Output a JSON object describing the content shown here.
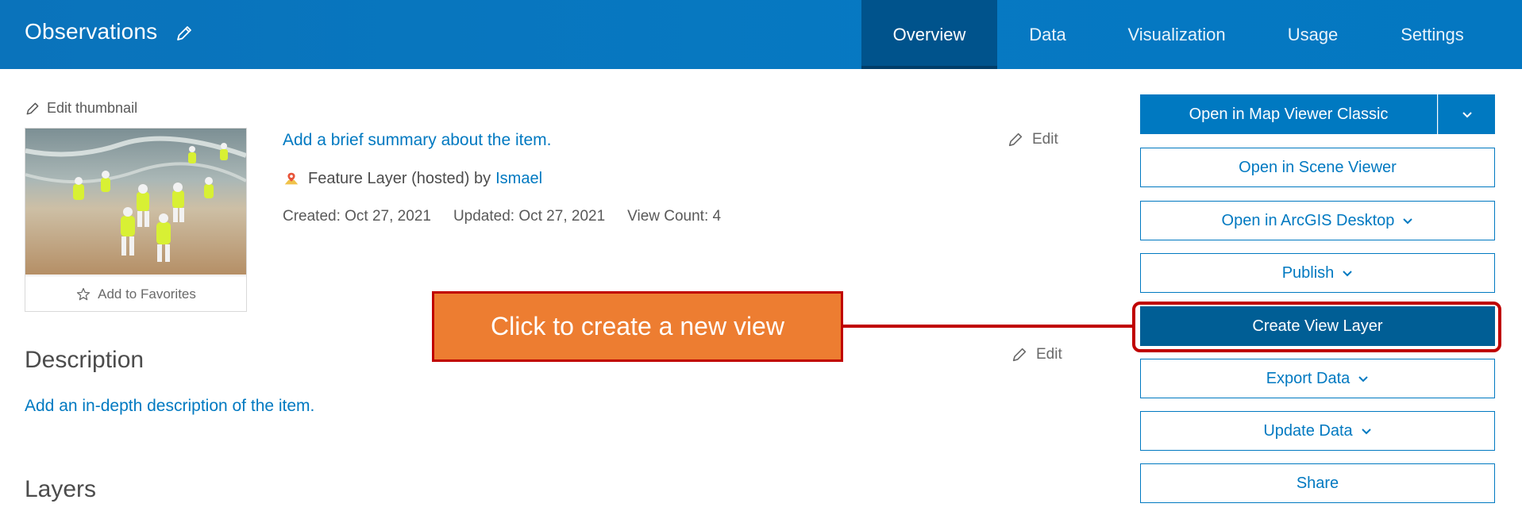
{
  "header": {
    "title": "Observations",
    "tabs": [
      {
        "label": "Overview",
        "active": true
      },
      {
        "label": "Data",
        "active": false
      },
      {
        "label": "Visualization",
        "active": false
      },
      {
        "label": "Usage",
        "active": false
      },
      {
        "label": "Settings",
        "active": false
      }
    ]
  },
  "thumbnail": {
    "edit_label": "Edit thumbnail",
    "favorite_label": "Add to Favorites"
  },
  "summary": {
    "placeholder_link": "Add a brief summary about the item.",
    "edit_label": "Edit",
    "item_type": "Feature Layer (hosted) by",
    "owner": "Ismael",
    "created": "Created: Oct 27, 2021",
    "updated": "Updated: Oct 27, 2021",
    "view_count": "View Count: 4"
  },
  "description": {
    "heading": "Description",
    "edit_label": "Edit",
    "placeholder_link": "Add an in-depth description of the item."
  },
  "layers": {
    "heading": "Layers"
  },
  "actions": {
    "open_map_viewer": "Open in Map Viewer Classic",
    "open_scene_viewer": "Open in Scene Viewer",
    "open_desktop": "Open in ArcGIS Desktop",
    "publish": "Publish",
    "create_view_layer": "Create View Layer",
    "export_data": "Export Data",
    "update_data": "Update Data",
    "share": "Share"
  },
  "annotation": {
    "callout_text": "Click to create a new view"
  },
  "colors": {
    "header_blue": "#0679c2",
    "active_tab": "#00538c",
    "link_blue": "#0079c1",
    "callout_orange": "#ed7d31",
    "callout_red": "#c00000"
  }
}
